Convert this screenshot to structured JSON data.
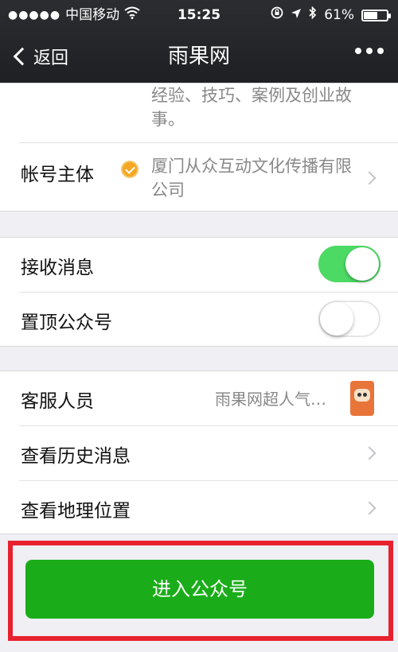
{
  "status_bar": {
    "carrier": "中国移动",
    "time": "15:25",
    "battery": "61%",
    "battery_level": 0.61
  },
  "nav": {
    "back_label": "返回",
    "title": "雨果网"
  },
  "info": {
    "intro_tail": "经验、技巧、案例及创业故事。",
    "account_owner_label": "帐号主体",
    "account_owner_value": "厦门从众互动文化传播有限公司"
  },
  "settings": {
    "receive_label": "接收消息",
    "receive_on": true,
    "pin_label": "置顶公众号",
    "pin_on": false
  },
  "menu": {
    "service_label": "客服人员",
    "service_value": "雨果网超人气…",
    "history_label": "查看历史消息",
    "location_label": "查看地理位置"
  },
  "action": {
    "enter_label": "进入公众号"
  },
  "colors": {
    "accent_green": "#1aad19",
    "toggle_on": "#4cd964",
    "highlight_red": "#e8212e"
  }
}
